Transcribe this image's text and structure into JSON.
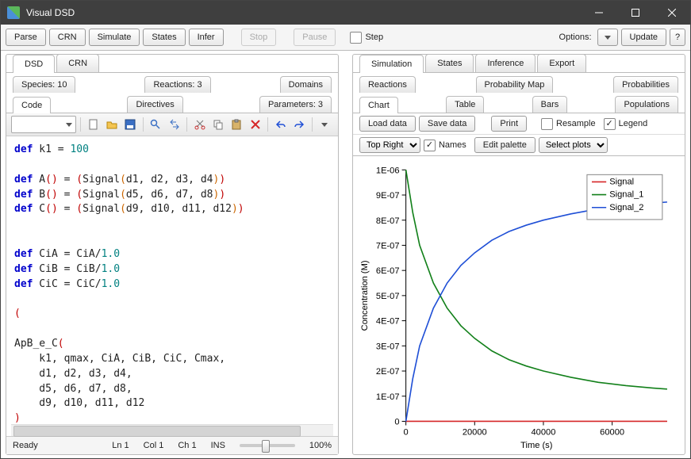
{
  "window": {
    "title": "Visual DSD"
  },
  "toolbar": {
    "parse": "Parse",
    "crn": "CRN",
    "simulate": "Simulate",
    "states": "States",
    "infer": "Infer",
    "stop": "Stop",
    "pause": "Pause",
    "step": "Step",
    "options": "Options:",
    "update": "Update"
  },
  "leftTabs": {
    "dsd": "DSD",
    "crn": "CRN"
  },
  "leftSubTop": {
    "species": "Species: 10",
    "reactions": "Reactions: 3",
    "domains": "Domains"
  },
  "leftSubBottom": {
    "code": "Code",
    "directives": "Directives",
    "parameters": "Parameters: 3"
  },
  "code": {
    "l1a": "def",
    "l1b": " k1 = ",
    "l1c": "100",
    "l3a": "def",
    "l3b": " A",
    "l3c": "()",
    "l3d": " = ",
    "l3e": "(",
    "l3f": "Signal",
    "l3g": "(",
    "l3h": "d1, d2, d3, d4",
    "l3i": ")",
    "l3j": ")",
    "l4a": "def",
    "l4b": " B",
    "l4c": "()",
    "l4d": " = ",
    "l4e": "(",
    "l4f": "Signal",
    "l4g": "(",
    "l4h": "d5, d6, d7, d8",
    "l4i": ")",
    "l4j": ")",
    "l5a": "def",
    "l5b": " C",
    "l5c": "()",
    "l5d": " = ",
    "l5e": "(",
    "l5f": "Signal",
    "l5g": "(",
    "l5h": "d9, d10, d11, d12",
    "l5i": ")",
    "l5j": ")",
    "l8a": "def",
    "l8b": " CiA = CiA/",
    "l8c": "1.0",
    "l9a": "def",
    "l9b": " CiB = CiB/",
    "l9c": "1.0",
    "l10a": "def",
    "l10b": " CiC = CiC/",
    "l10c": "1.0",
    "l12": "(",
    "l14a": "ApB_e_C",
    "l14b": "(",
    "l15": "    k1, qmax, CiA, CiB, CiC, Cmax,",
    "l16": "    d1, d2, d3, d4,",
    "l17": "    d5, d6, d7, d8,",
    "l18": "    d9, d10, d11, d12",
    "l19": ")",
    "l20": ")"
  },
  "status": {
    "ready": "Ready",
    "ln": "Ln 1",
    "col": "Col 1",
    "ch": "Ch 1",
    "ins": "INS",
    "zoom": "100%"
  },
  "rightTabs": {
    "simulation": "Simulation",
    "states": "States",
    "inference": "Inference",
    "export": "Export"
  },
  "rightSubTop": {
    "reactions": "Reactions",
    "probmap": "Probability Map",
    "probs": "Probabilities"
  },
  "rightSubBottom": {
    "chart": "Chart",
    "table": "Table",
    "bars": "Bars",
    "populations": "Populations"
  },
  "chartbar": {
    "load": "Load data",
    "save": "Save data",
    "print": "Print",
    "resample": "Resample",
    "legend": "Legend",
    "position": "Top Right",
    "names": "Names",
    "editpal": "Edit palette",
    "selplots": "Select plots"
  },
  "chart_data": {
    "type": "line",
    "title": "",
    "xlabel": "Time (s)",
    "ylabel": "Concentration (M)",
    "xlim": [
      0,
      76000
    ],
    "ylim": [
      0,
      1e-06
    ],
    "xticks": [
      0,
      20000,
      40000,
      60000
    ],
    "yticks": [
      "0",
      "1E-07",
      "2E-07",
      "3E-07",
      "4E-07",
      "5E-07",
      "6E-07",
      "7E-07",
      "8E-07",
      "9E-07",
      "1E-06"
    ],
    "legend_position": "top-right",
    "series": [
      {
        "name": "Signal",
        "color": "#d62728",
        "x": [
          0,
          76000
        ],
        "y": [
          0,
          0
        ]
      },
      {
        "name": "Signal_1",
        "color": "#12801a",
        "x": [
          0,
          2000,
          4000,
          8000,
          12000,
          16000,
          20000,
          25000,
          30000,
          35000,
          40000,
          48000,
          56000,
          64000,
          72000,
          76000
        ],
        "y": [
          1e-06,
          8.3e-07,
          7e-07,
          5.5e-07,
          4.5e-07,
          3.8e-07,
          3.3e-07,
          2.8e-07,
          2.45e-07,
          2.2e-07,
          2e-07,
          1.75e-07,
          1.55e-07,
          1.42e-07,
          1.32e-07,
          1.28e-07
        ]
      },
      {
        "name": "Signal_2",
        "color": "#1f4fd6",
        "x": [
          0,
          2000,
          4000,
          8000,
          12000,
          16000,
          20000,
          25000,
          30000,
          35000,
          40000,
          48000,
          56000,
          64000,
          72000,
          76000
        ],
        "y": [
          0,
          1.7e-07,
          3e-07,
          4.5e-07,
          5.5e-07,
          6.2e-07,
          6.7e-07,
          7.2e-07,
          7.55e-07,
          7.8e-07,
          8e-07,
          8.25e-07,
          8.45e-07,
          8.58e-07,
          8.68e-07,
          8.72e-07
        ]
      }
    ]
  }
}
